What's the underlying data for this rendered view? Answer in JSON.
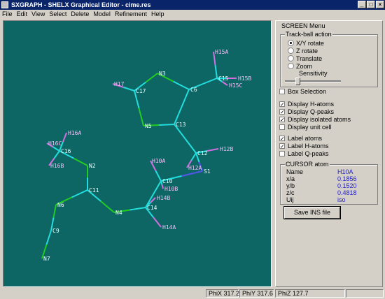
{
  "window": {
    "title": "SXGRAPH - SHELX Graphical Editor - cime.res",
    "min_glyph": "_",
    "max_glyph": "□",
    "close_glyph": "×"
  },
  "menu": [
    "File",
    "Edit",
    "View",
    "Select",
    "Delete",
    "Model",
    "Refinement",
    "Help"
  ],
  "panel": {
    "title": "SCREEN Menu",
    "trackball": {
      "title": "Track-ball action",
      "options": [
        "X/Y rotate",
        "Z rotate",
        "Translate",
        "Zoom"
      ],
      "selected": "X/Y rotate",
      "sensitivity_label": "Sensitivity",
      "sensitivity_level": 0.2
    },
    "checks": [
      {
        "label": "Box Selection",
        "checked": false
      },
      {
        "label": "Display H-atoms",
        "checked": true
      },
      {
        "label": "Display Q-peaks",
        "checked": true
      },
      {
        "label": "Display isolated atoms",
        "checked": true
      },
      {
        "label": "Display unit cell",
        "checked": false
      },
      {
        "label": "Label atoms",
        "checked": true
      },
      {
        "label": "Label H-atoms",
        "checked": true
      },
      {
        "label": "Label Q-peaks",
        "checked": false
      }
    ],
    "cursor": {
      "title": "CURSOR atom",
      "rows": [
        {
          "key": "Name",
          "value": "H10A"
        },
        {
          "key": "x/a",
          "value": "0.1856"
        },
        {
          "key": "y/b",
          "value": "0.1520"
        },
        {
          "key": "z/c",
          "value": "0.4818"
        },
        {
          "key": "Uij",
          "value": "iso"
        }
      ]
    },
    "save_label": "Save INS file"
  },
  "status": [
    {
      "label": "PhiX",
      "value": "317.2"
    },
    {
      "label": "PhiY",
      "value": "317.6"
    },
    {
      "label": "PhiZ",
      "value": "127.7"
    }
  ],
  "colors": {
    "background": "#0e6664",
    "carbon": "#22dddd",
    "nitrogen": "#22cc22",
    "sulfur": "#5555ee",
    "hydrogen": "#d070e0"
  },
  "molecule": {
    "labels": [
      "H15A",
      "C15",
      "H15B",
      "H15C",
      "H17",
      "C17",
      "N3",
      "C6",
      "N5",
      "C13",
      "H16A",
      "H16C",
      "C16",
      "H16B",
      "N2",
      "H12B",
      "C12",
      "H12A",
      "S1",
      "H10A",
      "C10",
      "H10B",
      "H14B",
      "C11",
      "N4",
      "C14",
      "N6",
      "C9",
      "H14A",
      "N7"
    ]
  }
}
